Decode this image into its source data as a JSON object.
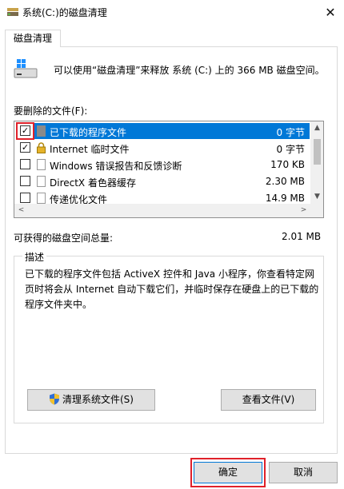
{
  "window": {
    "title": "系统(C:)的磁盘清理",
    "close_glyph": "✕"
  },
  "tab": {
    "label": "磁盘清理"
  },
  "summary": {
    "text": "可以使用“磁盘清理”来释放 系统 (C:) 上的 366 MB 磁盘空间。"
  },
  "files_label": "要删除的文件(F):",
  "file_list": [
    {
      "checked": true,
      "name": "已下载的程序文件",
      "size": "0 字节",
      "selected": true,
      "icon": "folder-icon"
    },
    {
      "checked": true,
      "name": "Internet 临时文件",
      "size": "0 字节",
      "selected": false,
      "icon": "lock-icon"
    },
    {
      "checked": false,
      "name": "Windows 错误报告和反馈诊断",
      "size": "170 KB",
      "selected": false,
      "icon": "file-icon"
    },
    {
      "checked": false,
      "name": "DirectX 着色器缓存",
      "size": "2.30 MB",
      "selected": false,
      "icon": "file-icon"
    },
    {
      "checked": false,
      "name": "传递优化文件",
      "size": "14.9 MB",
      "selected": false,
      "icon": "file-icon"
    }
  ],
  "scroll": {
    "up": "▲",
    "down": "▼",
    "left": "<",
    "right": ">"
  },
  "totals": {
    "label": "可获得的磁盘空间总量:",
    "value": "2.01 MB"
  },
  "description": {
    "legend": "描述",
    "text": "已下载的程序文件包括 ActiveX 控件和 Java 小程序，你查看特定网页时将会从 Internet 自动下载它们，并临时保存在硬盘上的已下载的程序文件夹中。"
  },
  "buttons": {
    "cleanup": "清理系统文件(S)",
    "view": "查看文件(V)",
    "ok": "确定",
    "cancel": "取消"
  },
  "colors": {
    "selection": "#0078d7",
    "highlight_box": "#e0212a",
    "button_face": "#e1e1e1"
  }
}
